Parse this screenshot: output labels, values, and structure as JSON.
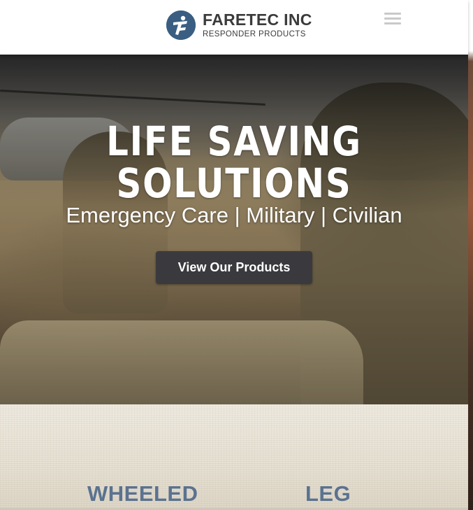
{
  "header": {
    "brand_name": "FARETEC INC",
    "brand_sub": "RESPONDER PRODUCTS",
    "logo_icon": "faretec-logo-mark",
    "menu_icon": "hamburger-menu-icon"
  },
  "hero": {
    "title_line1": "LIFE SAVING",
    "title_line2": "SOLUTIONS",
    "subtitle": "Emergency Care | Military | Civilian",
    "cta_label": "View Our Products"
  },
  "products": {
    "items": [
      {
        "label": "WHEELED"
      },
      {
        "label": "LEG"
      }
    ]
  },
  "colors": {
    "brand_blue": "#3a5e82",
    "cta_background": "#3a3a3e",
    "product_heading": "#5b7290"
  }
}
